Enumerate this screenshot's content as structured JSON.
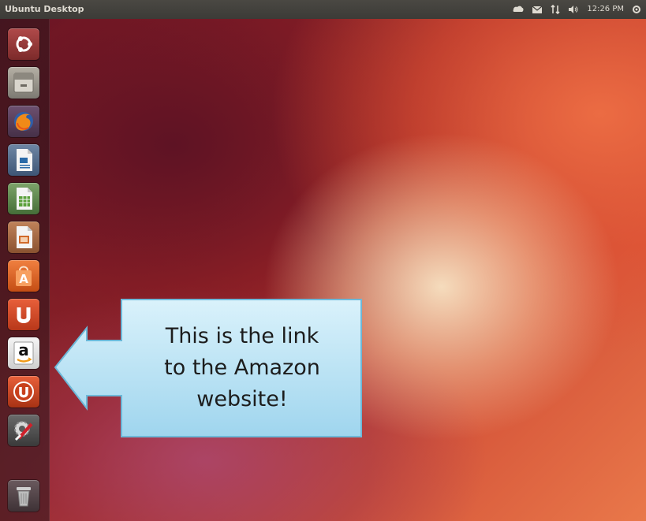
{
  "panel": {
    "title": "Ubuntu Desktop",
    "clock": "12:26 PM",
    "indicators": [
      "messaging-icon",
      "mail-icon",
      "network-icon",
      "volume-icon",
      "session-gear-icon"
    ]
  },
  "launcher": {
    "items": [
      {
        "name": "dash-home",
        "icon": "ubuntu-logo-icon"
      },
      {
        "name": "files",
        "icon": "file-cabinet-icon"
      },
      {
        "name": "firefox",
        "icon": "firefox-icon"
      },
      {
        "name": "libreoffice-writer",
        "icon": "writer-document-icon"
      },
      {
        "name": "libreoffice-calc",
        "icon": "calc-spreadsheet-icon"
      },
      {
        "name": "libreoffice-impress",
        "icon": "impress-presentation-icon"
      },
      {
        "name": "ubuntu-software-center",
        "icon": "shopping-bag-icon"
      },
      {
        "name": "ubuntu-one",
        "icon": "ubuntu-one-icon"
      },
      {
        "name": "amazon",
        "icon": "amazon-icon",
        "letter": "a"
      },
      {
        "name": "ubuntu-one-music",
        "icon": "ubuntu-one-music-icon"
      },
      {
        "name": "system-settings",
        "icon": "settings-wrench-icon"
      },
      {
        "name": "trash",
        "icon": "trash-icon"
      }
    ]
  },
  "callout": {
    "line1": "This is the link",
    "line2": "to the Amazon",
    "line3": "website!",
    "fill_top": "#d9f1fb",
    "fill_bottom": "#9fd6ee",
    "border": "#6db8d8"
  },
  "colors": {
    "wallpaper_dark": "#5a1528",
    "wallpaper_mid": "#a02a2a",
    "wallpaper_light": "#e9784a",
    "panel": "#3c3b37"
  }
}
